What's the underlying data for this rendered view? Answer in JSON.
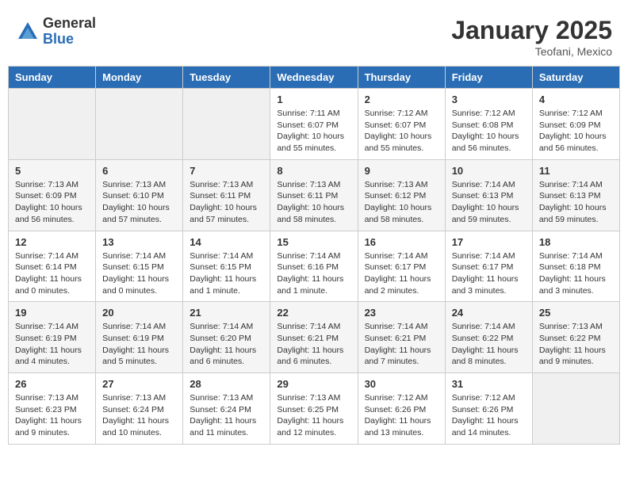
{
  "header": {
    "logo_general": "General",
    "logo_blue": "Blue",
    "title": "January 2025",
    "subtitle": "Teofani, Mexico"
  },
  "days_of_week": [
    "Sunday",
    "Monday",
    "Tuesday",
    "Wednesday",
    "Thursday",
    "Friday",
    "Saturday"
  ],
  "weeks": [
    {
      "days": [
        {
          "number": "",
          "info": "",
          "empty": true
        },
        {
          "number": "",
          "info": "",
          "empty": true
        },
        {
          "number": "",
          "info": "",
          "empty": true
        },
        {
          "number": "1",
          "info": "Sunrise: 7:11 AM\nSunset: 6:07 PM\nDaylight: 10 hours\nand 55 minutes.",
          "empty": false
        },
        {
          "number": "2",
          "info": "Sunrise: 7:12 AM\nSunset: 6:07 PM\nDaylight: 10 hours\nand 55 minutes.",
          "empty": false
        },
        {
          "number": "3",
          "info": "Sunrise: 7:12 AM\nSunset: 6:08 PM\nDaylight: 10 hours\nand 56 minutes.",
          "empty": false
        },
        {
          "number": "4",
          "info": "Sunrise: 7:12 AM\nSunset: 6:09 PM\nDaylight: 10 hours\nand 56 minutes.",
          "empty": false
        }
      ]
    },
    {
      "days": [
        {
          "number": "5",
          "info": "Sunrise: 7:13 AM\nSunset: 6:09 PM\nDaylight: 10 hours\nand 56 minutes.",
          "empty": false
        },
        {
          "number": "6",
          "info": "Sunrise: 7:13 AM\nSunset: 6:10 PM\nDaylight: 10 hours\nand 57 minutes.",
          "empty": false
        },
        {
          "number": "7",
          "info": "Sunrise: 7:13 AM\nSunset: 6:11 PM\nDaylight: 10 hours\nand 57 minutes.",
          "empty": false
        },
        {
          "number": "8",
          "info": "Sunrise: 7:13 AM\nSunset: 6:11 PM\nDaylight: 10 hours\nand 58 minutes.",
          "empty": false
        },
        {
          "number": "9",
          "info": "Sunrise: 7:13 AM\nSunset: 6:12 PM\nDaylight: 10 hours\nand 58 minutes.",
          "empty": false
        },
        {
          "number": "10",
          "info": "Sunrise: 7:14 AM\nSunset: 6:13 PM\nDaylight: 10 hours\nand 59 minutes.",
          "empty": false
        },
        {
          "number": "11",
          "info": "Sunrise: 7:14 AM\nSunset: 6:13 PM\nDaylight: 10 hours\nand 59 minutes.",
          "empty": false
        }
      ]
    },
    {
      "days": [
        {
          "number": "12",
          "info": "Sunrise: 7:14 AM\nSunset: 6:14 PM\nDaylight: 11 hours\nand 0 minutes.",
          "empty": false
        },
        {
          "number": "13",
          "info": "Sunrise: 7:14 AM\nSunset: 6:15 PM\nDaylight: 11 hours\nand 0 minutes.",
          "empty": false
        },
        {
          "number": "14",
          "info": "Sunrise: 7:14 AM\nSunset: 6:15 PM\nDaylight: 11 hours\nand 1 minute.",
          "empty": false
        },
        {
          "number": "15",
          "info": "Sunrise: 7:14 AM\nSunset: 6:16 PM\nDaylight: 11 hours\nand 1 minute.",
          "empty": false
        },
        {
          "number": "16",
          "info": "Sunrise: 7:14 AM\nSunset: 6:17 PM\nDaylight: 11 hours\nand 2 minutes.",
          "empty": false
        },
        {
          "number": "17",
          "info": "Sunrise: 7:14 AM\nSunset: 6:17 PM\nDaylight: 11 hours\nand 3 minutes.",
          "empty": false
        },
        {
          "number": "18",
          "info": "Sunrise: 7:14 AM\nSunset: 6:18 PM\nDaylight: 11 hours\nand 3 minutes.",
          "empty": false
        }
      ]
    },
    {
      "days": [
        {
          "number": "19",
          "info": "Sunrise: 7:14 AM\nSunset: 6:19 PM\nDaylight: 11 hours\nand 4 minutes.",
          "empty": false
        },
        {
          "number": "20",
          "info": "Sunrise: 7:14 AM\nSunset: 6:19 PM\nDaylight: 11 hours\nand 5 minutes.",
          "empty": false
        },
        {
          "number": "21",
          "info": "Sunrise: 7:14 AM\nSunset: 6:20 PM\nDaylight: 11 hours\nand 6 minutes.",
          "empty": false
        },
        {
          "number": "22",
          "info": "Sunrise: 7:14 AM\nSunset: 6:21 PM\nDaylight: 11 hours\nand 6 minutes.",
          "empty": false
        },
        {
          "number": "23",
          "info": "Sunrise: 7:14 AM\nSunset: 6:21 PM\nDaylight: 11 hours\nand 7 minutes.",
          "empty": false
        },
        {
          "number": "24",
          "info": "Sunrise: 7:14 AM\nSunset: 6:22 PM\nDaylight: 11 hours\nand 8 minutes.",
          "empty": false
        },
        {
          "number": "25",
          "info": "Sunrise: 7:13 AM\nSunset: 6:22 PM\nDaylight: 11 hours\nand 9 minutes.",
          "empty": false
        }
      ]
    },
    {
      "days": [
        {
          "number": "26",
          "info": "Sunrise: 7:13 AM\nSunset: 6:23 PM\nDaylight: 11 hours\nand 9 minutes.",
          "empty": false
        },
        {
          "number": "27",
          "info": "Sunrise: 7:13 AM\nSunset: 6:24 PM\nDaylight: 11 hours\nand 10 minutes.",
          "empty": false
        },
        {
          "number": "28",
          "info": "Sunrise: 7:13 AM\nSunset: 6:24 PM\nDaylight: 11 hours\nand 11 minutes.",
          "empty": false
        },
        {
          "number": "29",
          "info": "Sunrise: 7:13 AM\nSunset: 6:25 PM\nDaylight: 11 hours\nand 12 minutes.",
          "empty": false
        },
        {
          "number": "30",
          "info": "Sunrise: 7:12 AM\nSunset: 6:26 PM\nDaylight: 11 hours\nand 13 minutes.",
          "empty": false
        },
        {
          "number": "31",
          "info": "Sunrise: 7:12 AM\nSunset: 6:26 PM\nDaylight: 11 hours\nand 14 minutes.",
          "empty": false
        },
        {
          "number": "",
          "info": "",
          "empty": true
        }
      ]
    }
  ]
}
